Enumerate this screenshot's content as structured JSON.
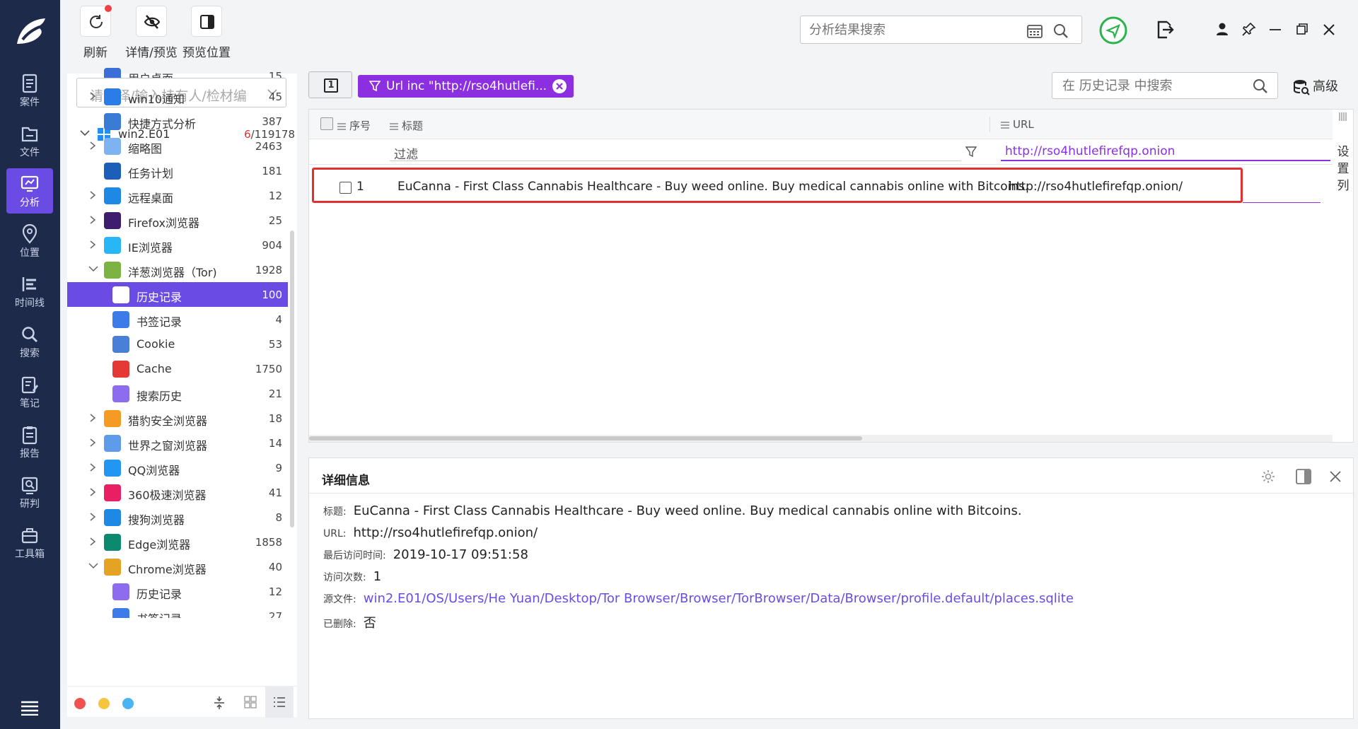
{
  "toolbar": {
    "refresh": "刷新",
    "detail_preview": "详情/预览",
    "preview_position": "预览位置",
    "search_placeholder": "分析结果搜索"
  },
  "nav": {
    "items": [
      "案件",
      "文件",
      "分析",
      "位置",
      "时间线",
      "搜索",
      "笔记",
      "报告",
      "研判",
      "工具箱"
    ],
    "active": "分析"
  },
  "tree": {
    "holder_placeholder": "请选择/输入持有人/检材编",
    "root": {
      "label": "win2.E01",
      "count_hit": "6",
      "count_total": "/119178"
    },
    "rows": [
      {
        "label": "用户桌面",
        "count": "15"
      },
      {
        "label": "win10通知",
        "count": "45"
      },
      {
        "label": "快捷方式分析",
        "count": "387"
      },
      {
        "label": "缩略图",
        "count": "2463"
      },
      {
        "label": "任务计划",
        "count": "181"
      },
      {
        "label": "远程桌面",
        "count": "12"
      },
      {
        "label": "Firefox浏览器",
        "count": "25"
      },
      {
        "label": "IE浏览器",
        "count": "904"
      },
      {
        "label": "洋葱浏览器（Tor)",
        "count": "1928"
      },
      {
        "label": "历史记录",
        "count": "100"
      },
      {
        "label": "书签记录",
        "count": "4"
      },
      {
        "label": "Cookie",
        "count": "53"
      },
      {
        "label": "Cache",
        "count": "1750"
      },
      {
        "label": "搜索历史",
        "count": "21"
      },
      {
        "label": "猎豹安全浏览器",
        "count": "18"
      },
      {
        "label": "世界之窗浏览器",
        "count": "14"
      },
      {
        "label": "QQ浏览器",
        "count": "9"
      },
      {
        "label": "360极速浏览器",
        "count": "41"
      },
      {
        "label": "搜狗浏览器",
        "count": "8"
      },
      {
        "label": "Edge浏览器",
        "count": "1858"
      },
      {
        "label": "Chrome浏览器",
        "count": "40"
      },
      {
        "label": "历史记录",
        "count": "12"
      },
      {
        "label": "书签记录",
        "count": "27"
      }
    ]
  },
  "filter": {
    "count_badge": "1",
    "chip_text": "Url inc \"http://rso4hutlefi...",
    "history_search_placeholder": "在 历史记录 中搜索",
    "advanced": "高级"
  },
  "grid": {
    "col_index": "序号",
    "col_title": "标题",
    "col_url": "URL",
    "filter_label": "过滤",
    "url_filter_value": "http://rso4hutlefirefqp.onion",
    "col_settings": [
      "设",
      "置",
      "列"
    ],
    "rows": [
      {
        "index": "1",
        "title": "EuCanna - First Class Cannabis Healthcare - Buy weed online. Buy medical cannabis online with Bitcoins.",
        "url": "http://rso4hutlefirefqp.onion/"
      }
    ]
  },
  "detail": {
    "header": "详细信息",
    "title_label": "标题:",
    "title_value": "EuCanna - First Class Cannabis Healthcare - Buy weed online. Buy medical cannabis online with Bitcoins.",
    "url_label": "URL:",
    "url_value": "http://rso4hutlefirefqp.onion/",
    "last_visit_label": "最后访问时间:",
    "last_visit_value": "2019-10-17 09:51:58",
    "visit_count_label": "访问次数:",
    "visit_count_value": "1",
    "source_label": "源文件:",
    "source_value": "win2.E01/OS/Users/He Yuan/Desktop/Tor Browser/Browser/TorBrowser/Data/Browser/profile.default/places.sqlite",
    "deleted_label": "已删除:",
    "deleted_value": "否"
  },
  "colors": {
    "nav_bg": "#1e2a4a",
    "accent": "#6a4ce4",
    "chip": "#8b2fe0",
    "highlight_border": "#e03030"
  }
}
